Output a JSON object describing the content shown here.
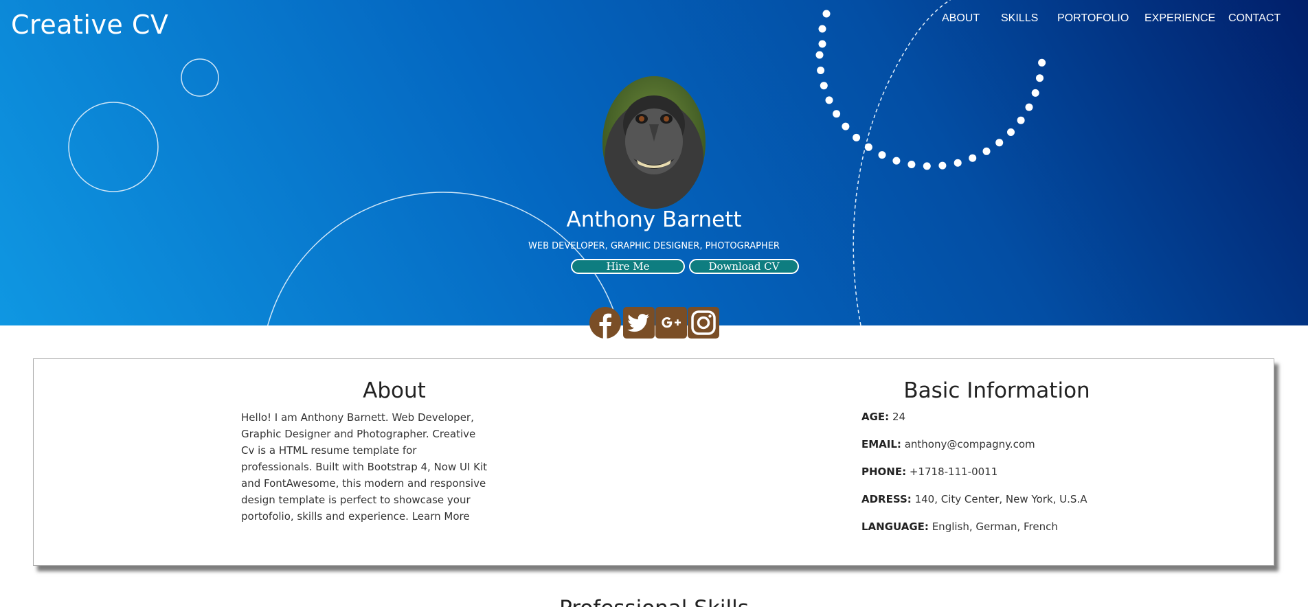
{
  "brand": "Creative CV",
  "nav": [
    "ABOUT",
    "SKILLS",
    "PORTOFOLIO",
    "EXPERIENCE",
    "CONTACT"
  ],
  "hero": {
    "name": "Anthony Barnett",
    "roles": "WEB DEVELOPER, GRAPHIC DESIGNER, PHOTOGRAPHER",
    "hire_label": "Hire Me",
    "cv_label": "Download CV"
  },
  "social": [
    "facebook-icon",
    "twitter-icon",
    "google-plus-icon",
    "instagram-icon"
  ],
  "colors": {
    "hero_start": "#0f97e2",
    "hero_end": "#011f6a",
    "button": "#0e7d80",
    "social_icon": "#7a4e26"
  },
  "about": {
    "title": "About",
    "text": "Hello! I am Anthony Barnett. Web Developer, Graphic Designer and Photographer. Creative Cv is a HTML resume template for professionals. Built with Bootstrap 4, Now UI Kit and FontAwesome, this modern and responsive design template is perfect to showcase your portofolio, skills and experience.",
    "learn_more": "Learn More"
  },
  "basic_info": {
    "title": "Basic Information",
    "rows": [
      {
        "label": "AGE:",
        "value": "24"
      },
      {
        "label": "EMAIL:",
        "value": "anthony@compagny.com"
      },
      {
        "label": "PHONE:",
        "value": "+1718-111-0011"
      },
      {
        "label": "ADRESS:",
        "value": "140, City Center, New York, U.S.A"
      },
      {
        "label": "LANGUAGE:",
        "value": "English, German, French"
      }
    ]
  },
  "next_section_title": "Professional Skills"
}
